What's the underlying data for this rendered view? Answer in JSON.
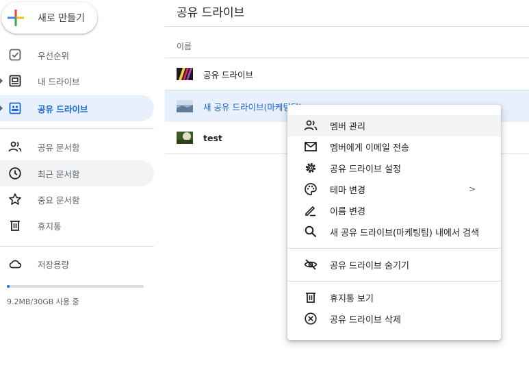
{
  "new_button": {
    "label": "새로 만들기"
  },
  "sidebar": {
    "items": [
      {
        "label": "우선순위",
        "icon": "priority-check-icon"
      },
      {
        "label": "내 드라이브",
        "icon": "my-drive-icon"
      },
      {
        "label": "공유 드라이브",
        "icon": "shared-drives-icon"
      },
      {
        "label": "공유 문서함",
        "icon": "shared-with-me-icon"
      },
      {
        "label": "최근 문서함",
        "icon": "recent-clock-icon"
      },
      {
        "label": "중요 문서함",
        "icon": "star-icon"
      },
      {
        "label": "휴지통",
        "icon": "trash-icon"
      },
      {
        "label": "저장용량",
        "icon": "cloud-icon"
      }
    ],
    "storage": {
      "text": "9.2MB/30GB 사용 중",
      "used_fraction": 0.02
    }
  },
  "main": {
    "title": "공유 드라이브",
    "column_header": "이름",
    "rows": [
      {
        "name": "공유 드라이브"
      },
      {
        "name": "새 공유 드라이브(마케팅팀)"
      },
      {
        "name": "test"
      }
    ]
  },
  "context_menu": {
    "items": [
      {
        "label": "멤버 관리",
        "icon": "people-icon"
      },
      {
        "label": "멤버에게 이메일 전송",
        "icon": "mail-icon"
      },
      {
        "label": "공유 드라이브 설정",
        "icon": "gear-icon"
      },
      {
        "label": "테마 변경",
        "icon": "palette-icon",
        "submenu_glyph": ">"
      },
      {
        "label": "이름 변경",
        "icon": "pencil-icon"
      },
      {
        "label": "새 공유 드라이브(마케팅팀) 내에서 검색",
        "icon": "search-icon"
      },
      {
        "label": "공유 드라이브 숨기기",
        "icon": "eye-off-icon"
      },
      {
        "label": "휴지통 보기",
        "icon": "trash-icon"
      },
      {
        "label": "공유 드라이브 삭제",
        "icon": "delete-circle-icon"
      }
    ]
  },
  "colors": {
    "accent": "#1a73e8",
    "selected_bg": "#e8f0fe",
    "hover_bg": "#f1f3f4",
    "icon_gray": "#5f6368"
  }
}
